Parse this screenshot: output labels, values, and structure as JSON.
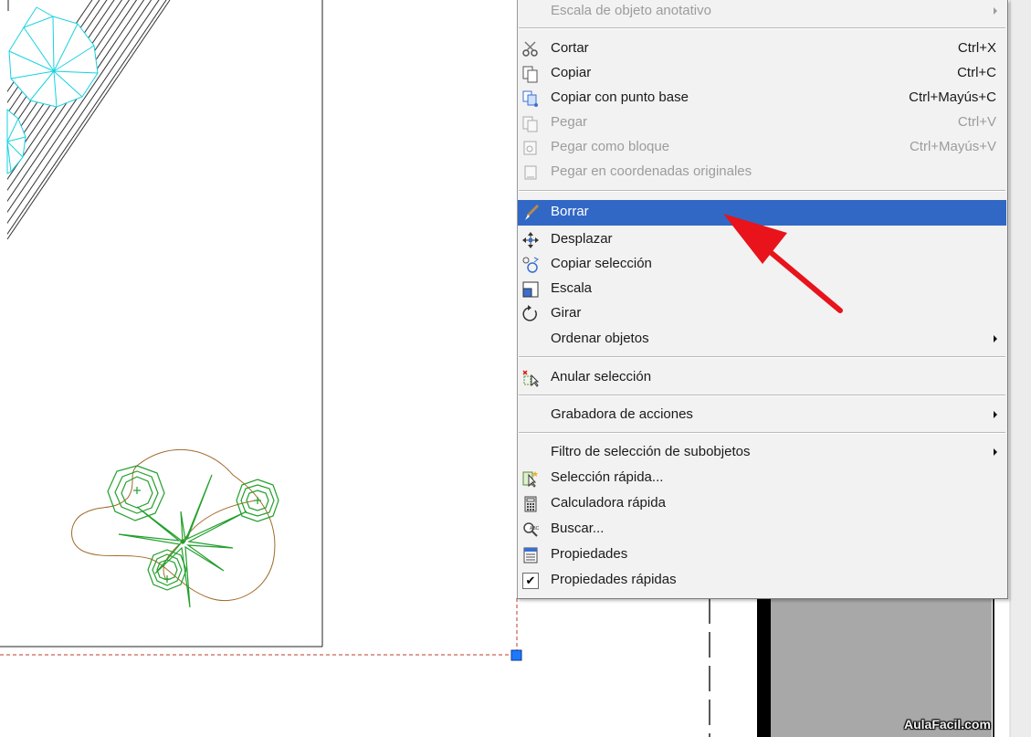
{
  "context_menu": {
    "items": [
      {
        "label": "Escala de objeto anotativo",
        "shortcut": "",
        "icon": "",
        "submenu": true,
        "disabled": true
      },
      {
        "label": "Cortar",
        "shortcut": "Ctrl+X",
        "icon": "scissors-icon"
      },
      {
        "label": "Copiar",
        "shortcut": "Ctrl+C",
        "icon": "copy-icon"
      },
      {
        "label": "Copiar con punto base",
        "shortcut": "Ctrl+Mayús+C",
        "icon": "copy-base-point-icon"
      },
      {
        "label": "Pegar",
        "shortcut": "Ctrl+V",
        "icon": "paste-icon",
        "disabled": true
      },
      {
        "label": "Pegar como bloque",
        "shortcut": "Ctrl+Mayús+V",
        "icon": "paste-block-icon",
        "disabled": true
      },
      {
        "label": "Pegar en coordenadas originales",
        "shortcut": "",
        "icon": "paste-original-coordinates-icon",
        "disabled": true
      },
      {
        "label": "Borrar",
        "shortcut": "",
        "icon": "eraser-icon",
        "highlighted": true
      },
      {
        "label": "Desplazar",
        "shortcut": "",
        "icon": "move-icon"
      },
      {
        "label": "Copiar selección",
        "shortcut": "",
        "icon": "copy-selection-icon"
      },
      {
        "label": "Escala",
        "shortcut": "",
        "icon": "scale-icon"
      },
      {
        "label": "Girar",
        "shortcut": "",
        "icon": "rotate-icon"
      },
      {
        "label": "Ordenar objetos",
        "shortcut": "",
        "icon": "",
        "submenu": true
      },
      {
        "label": "Anular selección",
        "shortcut": "",
        "icon": "deselect-icon"
      },
      {
        "label": "Grabadora de acciones",
        "shortcut": "",
        "icon": "",
        "submenu": true
      },
      {
        "label": "Filtro de selección de subobjetos",
        "shortcut": "",
        "icon": "",
        "submenu": true
      },
      {
        "label": "Selección rápida...",
        "shortcut": "",
        "icon": "quick-select-icon"
      },
      {
        "label": "Calculadora rápida",
        "shortcut": "",
        "icon": "calculator-icon"
      },
      {
        "label": "Buscar...",
        "shortcut": "",
        "icon": "find-icon"
      },
      {
        "label": "Propiedades",
        "shortcut": "",
        "icon": "properties-icon"
      },
      {
        "label": "Propiedades rápidas",
        "shortcut": "",
        "icon": "checkbox-icon",
        "checked": true
      }
    ]
  },
  "watermark": "AulaFacil.com",
  "colors": {
    "menu_bg": "#f2f2f2",
    "highlight": "#3168c6",
    "disabled_text": "#9c9c9c",
    "grip": "#1e78ff",
    "annotation_arrow": "#e8131b",
    "plant_cyan": "#15d3e0",
    "plant_green": "#22a02c",
    "plant_brown": "#a06a2a"
  }
}
